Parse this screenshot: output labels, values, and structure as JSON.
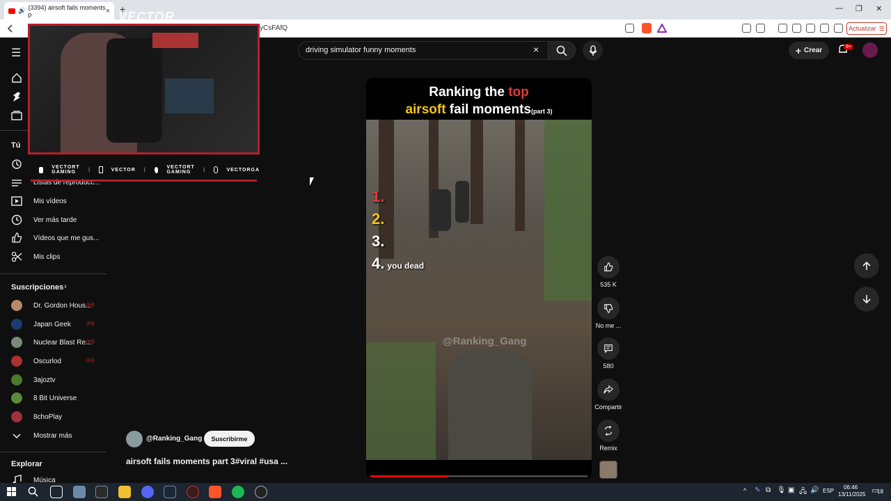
{
  "browser": {
    "tab_title": "(3394) airsoft fails moments p",
    "tab_close": "×",
    "new_tab": "+",
    "url_fragment": "yCsFAfQ",
    "update_label": "Actualizar",
    "window_minimize": "—",
    "window_restore": "❐",
    "window_close": "✕"
  },
  "header": {
    "search_value": "driving simulator funny moments",
    "search_clear": "×",
    "create_label": "Crear",
    "notif_count": "9+"
  },
  "sidebar": {
    "main_items": [
      {
        "label": "Inicio",
        "icon": "home-icon"
      },
      {
        "label": "Shorts",
        "icon": "shorts-icon"
      },
      {
        "label": "Suscripciones",
        "icon": "subscriptions-icon"
      }
    ],
    "you_title": "Tú",
    "you_items": [
      {
        "label": "Historial",
        "icon": "history-icon"
      },
      {
        "label": "Listas de reproducc...",
        "icon": "playlist-icon"
      },
      {
        "label": "Mis vídeos",
        "icon": "my-videos-icon"
      },
      {
        "label": "Ver más tarde",
        "icon": "watch-later-icon"
      },
      {
        "label": "Vídeos que me gus...",
        "icon": "liked-icon"
      },
      {
        "label": "Mis clips",
        "icon": "clips-icon"
      }
    ],
    "subs_title": "Suscripciones",
    "subscriptions": [
      {
        "name": "Dr. Gordon Hous...",
        "live": "((•))",
        "color": "#b78a6a"
      },
      {
        "name": "Japan Geek",
        "live": "((•))",
        "color": "#1d3b70"
      },
      {
        "name": "Nuclear Blast Re...",
        "live": "((•))",
        "color": "#7a8a7a"
      },
      {
        "name": "Oscurlod",
        "live": "((•))",
        "color": "#a83232"
      },
      {
        "name": "3ajoztv",
        "live": "",
        "color": "#4a7a2a"
      },
      {
        "name": "8 Bit Universe",
        "live": "",
        "color": "#5a8a3a"
      },
      {
        "name": "8choPlay",
        "live": "",
        "color": "#a03040"
      }
    ],
    "show_more": "Mostrar más",
    "explore_title": "Explorar",
    "explore_items": [
      {
        "label": "Música",
        "icon": "music-icon"
      }
    ]
  },
  "overlay": {
    "logo_text": "VECTOR",
    "socials": [
      {
        "icon": "youtube-icon",
        "text": "VECTORT GAMING"
      },
      {
        "icon": "twitch-icon",
        "text": "VECTOR"
      },
      {
        "icon": "twitter-icon",
        "text": "VECTORT GAMING"
      },
      {
        "icon": "instagram-icon",
        "text": "VECTORGA"
      }
    ],
    "separator": "|"
  },
  "short": {
    "header_line1_a": "Ranking the ",
    "header_line1_b": "top",
    "header_line2_a": "airsoft",
    "header_line2_b": " fail moments",
    "header_line2_c": "(part 3)",
    "ranks": [
      {
        "num": "1.",
        "color": "#e53935",
        "label": ""
      },
      {
        "num": "2.",
        "color": "#f5c518",
        "label": ""
      },
      {
        "num": "3.",
        "color": "#ffffff",
        "label": ""
      },
      {
        "num": "4.",
        "color": "#ffffff",
        "label": "you dead"
      }
    ],
    "watermark": "@Ranking_Gang",
    "progress": 0.36,
    "channel": "@Ranking_Gang",
    "subscribe_label": "Suscribirme",
    "title": "airsoft fails moments part 3#viral #usa ..."
  },
  "actions": {
    "likes": "535 K",
    "dislike": "No me ...",
    "comments": "580",
    "share": "Compartir",
    "remix": "Remix"
  },
  "taskbar": {
    "lang": "ESP",
    "time": "06:46",
    "date": "13/11/2025",
    "notif": "18"
  }
}
